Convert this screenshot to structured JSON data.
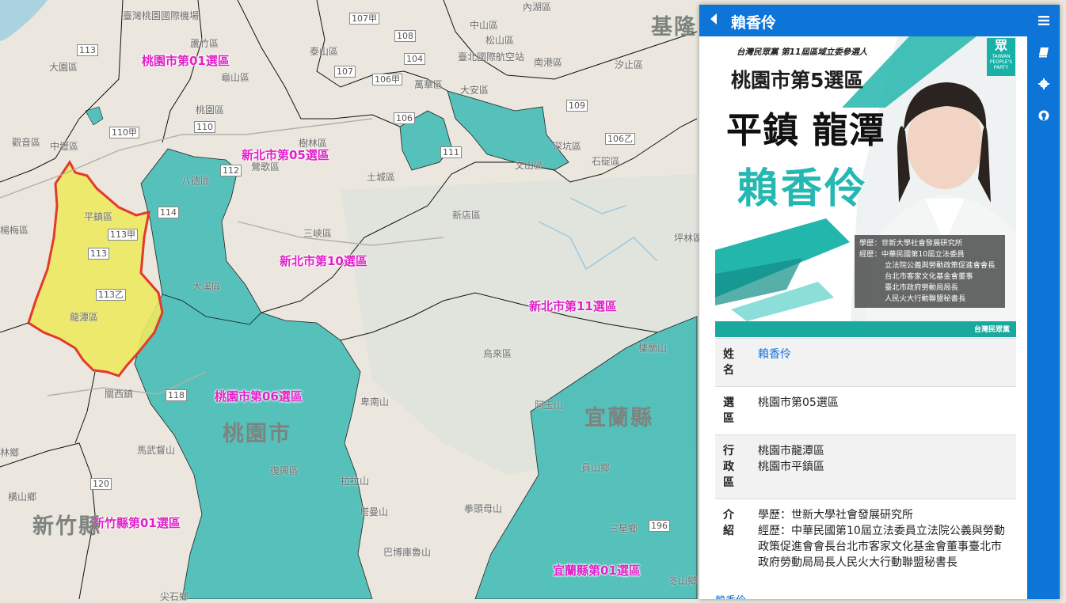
{
  "map": {
    "district_labels": [
      "桃園市第01選區",
      "新北市第05選區",
      "新北市第10選區",
      "新北市第11選區",
      "桃園市第06選區",
      "新竹縣第01選區",
      "宜蘭縣第01選區"
    ],
    "city_labels": [
      "基隆",
      "桃園市",
      "宜蘭縣",
      "新竹縣"
    ],
    "town_labels": [
      "臺灣桃園國際機場",
      "大園區",
      "蘆竹區",
      "泰山區",
      "龜山區",
      "桃園區",
      "八德區",
      "鶯歌區",
      "樹林區",
      "土城區",
      "新店區",
      "三峽區",
      "平鎮區",
      "龍潭區",
      "大溪區",
      "觀音區",
      "中壢區",
      "楊梅區",
      "關西鎮",
      "馬武督山",
      "橫山鄉",
      "復興區",
      "拉拉山",
      "塔曼山",
      "巴博庫魯山",
      "烏來區",
      "深坑區",
      "石碇區",
      "文山區",
      "大安區",
      "南港區",
      "汐止區",
      "萬華區",
      "臺北國際航空站",
      "中山區",
      "松山區",
      "內湖區",
      "三星鄉",
      "員山鄉",
      "棲蘭山",
      "卑南山",
      "阿玉山",
      "拳頭母山",
      "坪林區",
      "冬山鄉",
      "尖石鄉",
      "林鄉"
    ],
    "road_labels": [
      "113",
      "110甲",
      "110",
      "112",
      "114",
      "113甲",
      "113",
      "113乙",
      "118",
      "120",
      "107甲",
      "108",
      "107",
      "104",
      "106甲",
      "106",
      "106乙",
      "109",
      "111",
      "110",
      "196"
    ]
  },
  "sidebar": {
    "title": "賴香伶",
    "menu_icon": "hamburger-icon",
    "tabs": [
      "book-icon",
      "gear-icon",
      "github-icon"
    ],
    "poster": {
      "party_line": "台灣民眾黨 第11屆區域立委參選人",
      "district_line": "桃園市第5選區",
      "towns_line": "平鎮 龍潭",
      "name_line": "賴香伶",
      "cv": [
        "學歷：世新大學社會發展研究所",
        "經歷：中華民國第10屆立法委員",
        "立法院公義與勞動政策促進會會長",
        "台北市客家文化基金會董事",
        "臺北市政府勞動局局長",
        "人民火大行動聯盟秘書長"
      ],
      "logo_text": "眾 TAIWAN PEOPLE'S PARTY",
      "footer": "台灣民眾黨"
    },
    "info": [
      {
        "key": "姓名",
        "value": [
          "賴香伶"
        ],
        "link": true
      },
      {
        "key": "選區",
        "value": [
          "桃園市第05選區"
        ]
      },
      {
        "key": "行政區",
        "value": [
          "桃園市龍潭區",
          "桃園市平鎮區"
        ]
      },
      {
        "key": "介紹",
        "value": [
          "學歷：世新大學社會發展研究所",
          "經歷：中華民國第10屆立法委員立法院公義與勞動政策促進會會長台北市客家文化基金會董事臺北市政府勞動局局長人民火大行動聯盟秘書長"
        ]
      }
    ],
    "bottom_link": "賴香伶"
  },
  "colors": {
    "accent": "#0d74d8",
    "teal": "#3cb9b4",
    "selected": "#ede960",
    "selected_border": "#e23a2a",
    "label": "#e020c8"
  }
}
